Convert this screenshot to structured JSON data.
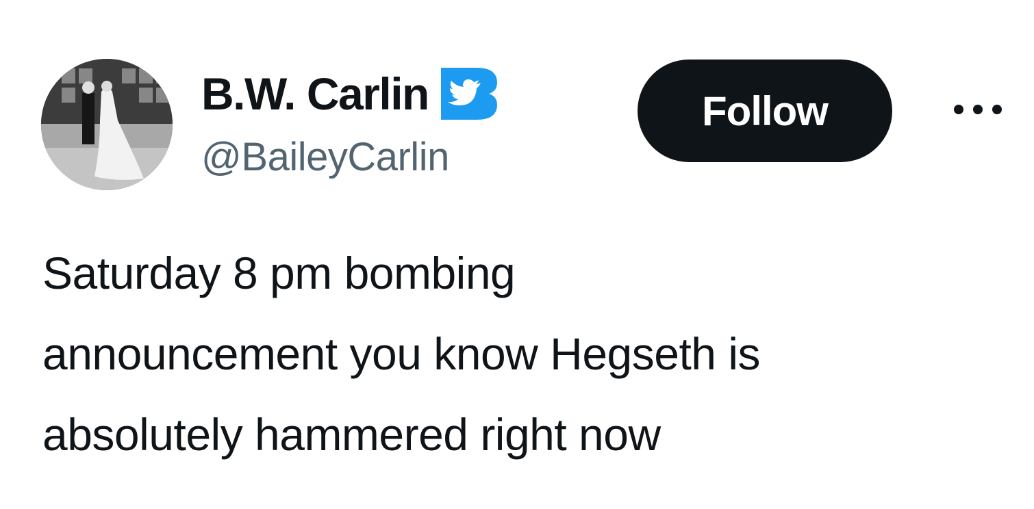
{
  "author": {
    "display_name": "B.W. Carlin",
    "handle": "@BaileyCarlin",
    "verified_badge_icon": "twitter-bird-b-badge",
    "avatar_icon": "wedding-photo-avatar"
  },
  "actions": {
    "follow_label": "Follow",
    "more_icon": "more-dots-icon"
  },
  "tweet": {
    "lines": [
      "Saturday 8 pm bombing",
      "announcement you know Hegseth is",
      "absolutely hammered right now"
    ]
  },
  "colors": {
    "text_primary": "#0f1419",
    "text_secondary": "#536471",
    "follow_bg": "#0f1419",
    "follow_text": "#ffffff",
    "badge_blue": "#1d9bf0"
  }
}
